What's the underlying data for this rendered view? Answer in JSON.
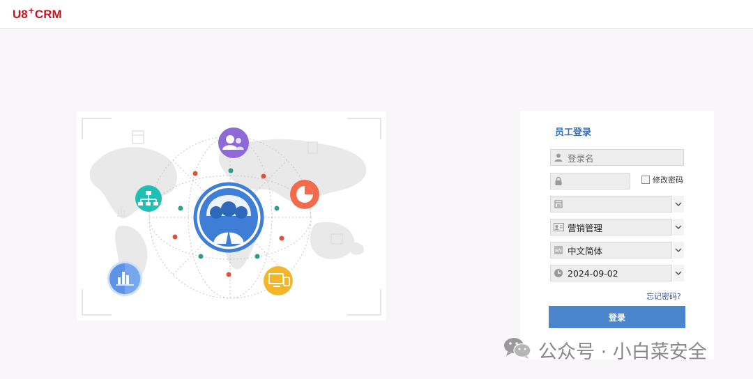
{
  "header": {
    "logo_u8": "U8",
    "logo_plus": "+",
    "logo_crm": "CRM"
  },
  "login": {
    "title": "员工登录",
    "username_placeholder": "登录名",
    "password_value": "",
    "modify_password_label": "修改密码",
    "account_value": "",
    "role_value": "营销管理",
    "language_value": "中文简体",
    "date_value": "2024-09-02",
    "forgot_password_link": "忘记密码?",
    "login_button": "登录"
  },
  "colors": {
    "brand_red": "#d0111b",
    "accent_blue": "#4b86cc",
    "title_blue": "#3a6fb8"
  },
  "illustration": {
    "center_icon": "users-cloud-icon",
    "satellite_icons": [
      "team-icon",
      "org-chart-icon",
      "pie-chart-icon",
      "bar-chart-icon",
      "devices-icon"
    ]
  },
  "watermark": {
    "text": "公众号 · 小白菜安全"
  }
}
